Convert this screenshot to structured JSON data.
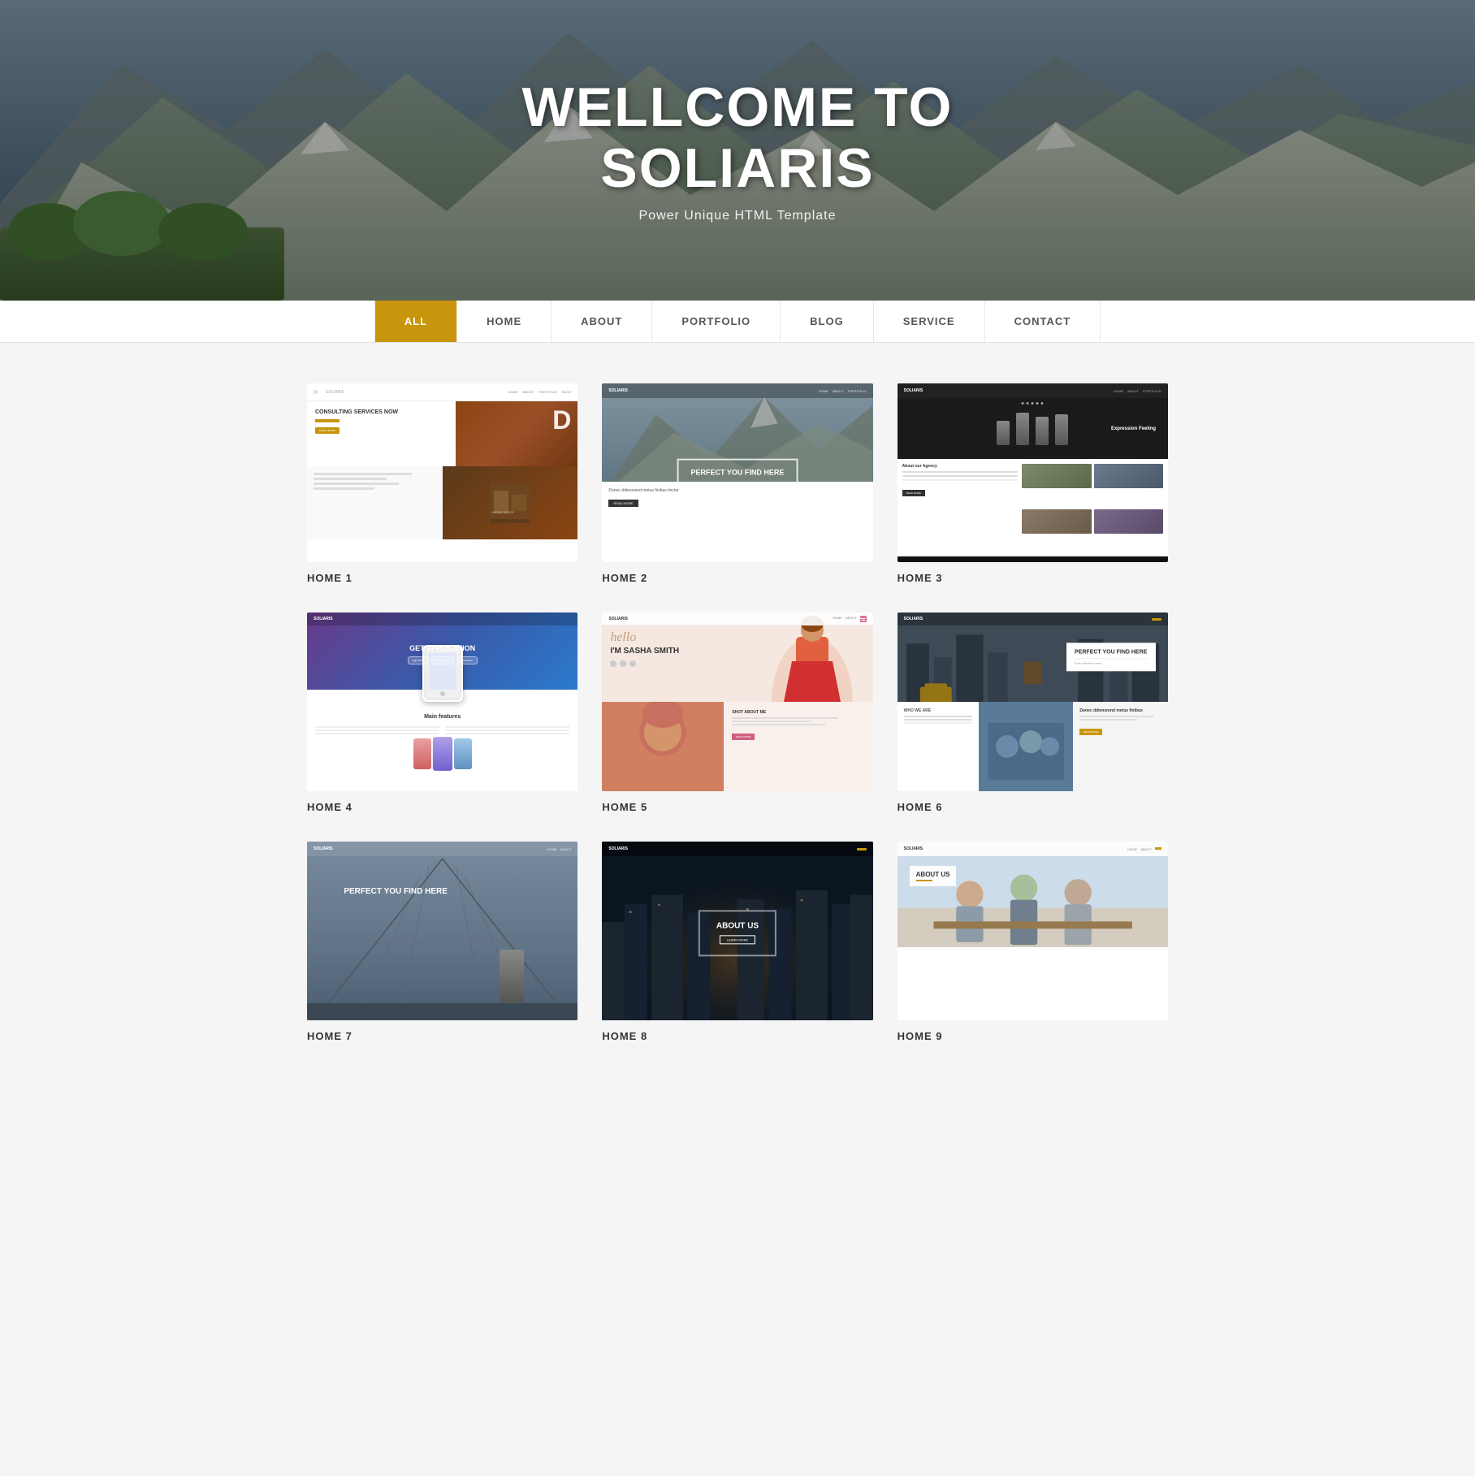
{
  "hero": {
    "title_line1": "WELLCOME TO",
    "title_line2": "SOLIARIS",
    "subtitle": "Power Unique HTML Template"
  },
  "nav": {
    "items": [
      {
        "id": "all",
        "label": "ALL",
        "active": true
      },
      {
        "id": "home",
        "label": "HOME",
        "active": false
      },
      {
        "id": "about",
        "label": "ABOUT",
        "active": false
      },
      {
        "id": "portfolio",
        "label": "PORTFOLIO",
        "active": false
      },
      {
        "id": "blog",
        "label": "BLOG",
        "active": false
      },
      {
        "id": "service",
        "label": "SERVICE",
        "active": false
      },
      {
        "id": "contact",
        "label": "CONTACT",
        "active": false
      }
    ]
  },
  "grid": {
    "items": [
      {
        "id": "home1",
        "label": "HOME 1",
        "consulting": "CONSULTING SERVICES NOW",
        "desc": "D"
      },
      {
        "id": "home2",
        "label": "HOME 2",
        "hero_text": "PERFECT YOU FIND HERE",
        "body_text": "Donec ddiensrend metus finibus tinctur"
      },
      {
        "id": "home3",
        "label": "HOME 3",
        "hero_title": "Expression Feeling",
        "agency_title": "About our Agency"
      },
      {
        "id": "home4",
        "label": "HOME 4",
        "get_app": "Get application",
        "features_title": "Main features"
      },
      {
        "id": "home5",
        "label": "HOME 5",
        "hello": "hello",
        "name": "I'm Sasha Smith",
        "about": "SHOT ABOUT ME"
      },
      {
        "id": "home6",
        "label": "HOME 6",
        "hero_text": "PERFECT YOU FIND HERE",
        "who": "WHO WE ARE",
        "desc": "Donec ddiensrend metus finibus"
      },
      {
        "id": "home7",
        "label": "HOME 7",
        "hero_text": "PERFECT YOU FIND HERE"
      },
      {
        "id": "home8",
        "label": "HOME 8",
        "about": "ABOUT US"
      },
      {
        "id": "home9",
        "label": "HOME 9",
        "about": "ABOUT US"
      }
    ]
  }
}
